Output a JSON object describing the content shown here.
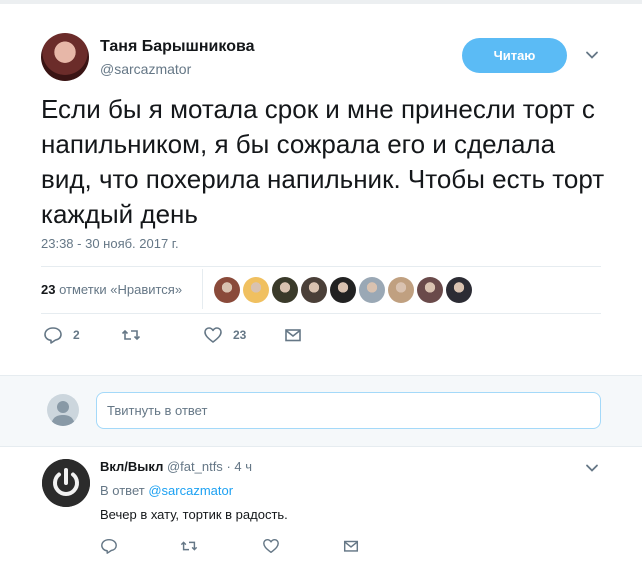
{
  "tweet": {
    "author_name": "Таня Барышникова",
    "author_handle": "@sarcazmator",
    "follow_label": "Читаю",
    "text": "Если бы я мотала срок и мне принесли торт с напильником, я бы сожрала его и сделала вид, что похерила напильник. Чтобы есть торт каждый день",
    "timestamp": "23:38 - 30 нояб. 2017 г.",
    "likes_count": "23",
    "likes_label": "отметки «Нравится»",
    "liker_colors": [
      "#8a4a3a",
      "#f0c060",
      "#3a3a2a",
      "#4a3f38",
      "#222222",
      "#9aa8b5",
      "#c0a080",
      "#6a4a4a",
      "#2c2c34"
    ],
    "actions": {
      "reply_count": "2",
      "retweet_count": "",
      "like_count": "23"
    }
  },
  "reply_box": {
    "placeholder": "Твитнуть в ответ"
  },
  "reply": {
    "author_name": "Вкл/Выкл",
    "author_handle": "@fat_ntfs",
    "dot": "·",
    "time": "4 ч",
    "in_reply_prefix": "В ответ",
    "in_reply_handle": "@sarcazmator",
    "text": "Вечер в хату, тортик в радость."
  },
  "colors": {
    "accent": "#1da1f2",
    "muted": "#657786",
    "border": "#e6ecf0"
  }
}
